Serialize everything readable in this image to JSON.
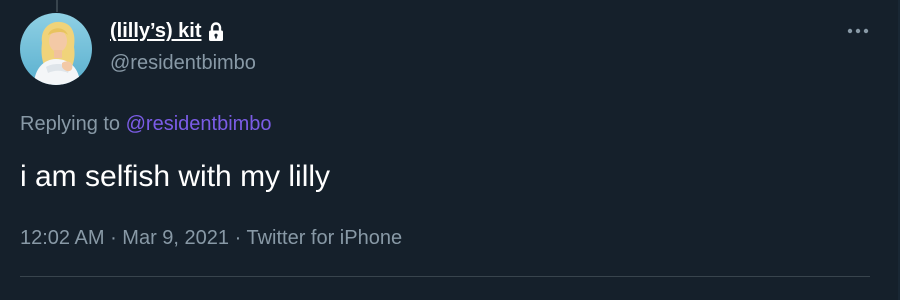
{
  "colors": {
    "background": "#15202b",
    "primary_text": "#ffffff",
    "secondary_text": "#8899a6",
    "mention": "#7b5ce6",
    "divider": "#38444d"
  },
  "tweet": {
    "author": {
      "display_name": "(lilly’s) kit",
      "handle": "@residentbimbo",
      "protected_icon": "lock-icon",
      "avatar_icon": "avatar"
    },
    "more_icon": "more-options-icon",
    "reply_context": {
      "prefix": "Replying to ",
      "mention": "@residentbimbo"
    },
    "text": "i am selfish with my lilly",
    "time": "12:02 AM",
    "separator": " · ",
    "date": "Mar 9, 2021",
    "source": "Twitter for iPhone"
  }
}
